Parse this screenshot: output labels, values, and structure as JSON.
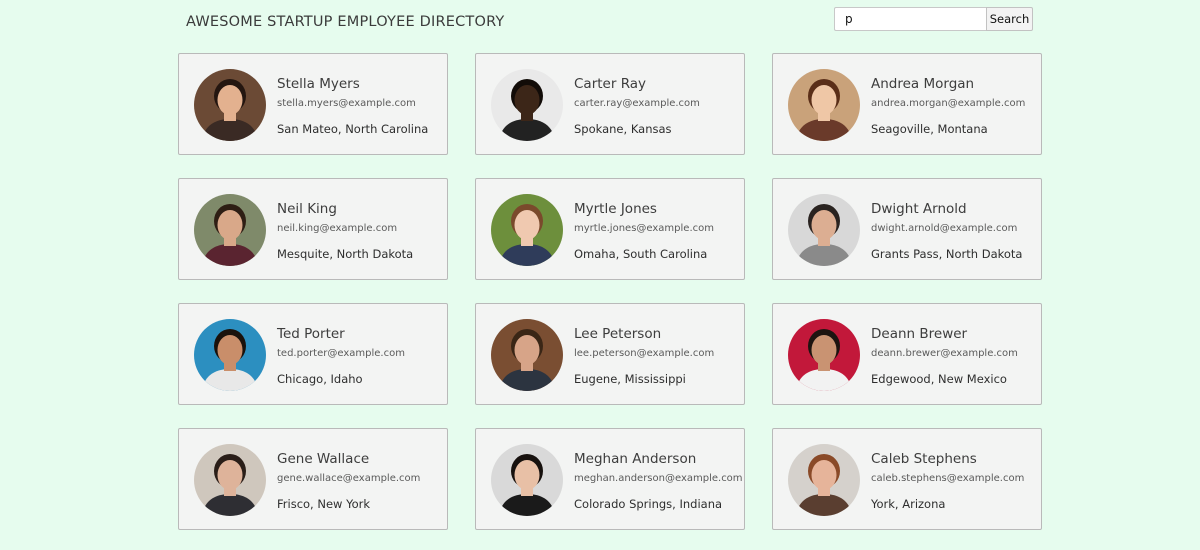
{
  "header": {
    "title": "AWESOME STARTUP EMPLOYEE DIRECTORY"
  },
  "search": {
    "value": "p",
    "button_label": "Search"
  },
  "employees": [
    {
      "name": "Stella Myers",
      "email": "stella.myers@example.com",
      "location": "San Mateo, North Carolina",
      "bg": "#6b4a35",
      "skin": "#e3b18f",
      "hair": "#241610",
      "shirt": "#3a2a24"
    },
    {
      "name": "Carter Ray",
      "email": "carter.ray@example.com",
      "location": "Spokane, Kansas",
      "bg": "#e9e9e9",
      "skin": "#3c2618",
      "hair": "#120c08",
      "shirt": "#222222"
    },
    {
      "name": "Andrea Morgan",
      "email": "andrea.morgan@example.com",
      "location": "Seagoville, Montana",
      "bg": "#c9a27a",
      "skin": "#efc7a6",
      "hair": "#5a2e18",
      "shirt": "#6a3a2a"
    },
    {
      "name": "Neil King",
      "email": "neil.king@example.com",
      "location": "Mesquite, North Dakota",
      "bg": "#7f8a6a",
      "skin": "#d9a889",
      "hair": "#2e1e14",
      "shirt": "#5a2430"
    },
    {
      "name": "Myrtle Jones",
      "email": "myrtle.jones@example.com",
      "location": "Omaha, South Carolina",
      "bg": "#6d8f3c",
      "skin": "#f0c9b0",
      "hair": "#7a4a2c",
      "shirt": "#2f3c5a"
    },
    {
      "name": "Dwight Arnold",
      "email": "dwight.arnold@example.com",
      "location": "Grants Pass, North Dakota",
      "bg": "#d8d8d8",
      "skin": "#dcae92",
      "hair": "#2a2320",
      "shirt": "#8a8a8a"
    },
    {
      "name": "Ted Porter",
      "email": "ted.porter@example.com",
      "location": "Chicago, Idaho",
      "bg": "#2c8fc0",
      "skin": "#c98e6a",
      "hair": "#1a120c",
      "shirt": "#e8e8e8"
    },
    {
      "name": "Lee Peterson",
      "email": "lee.peterson@example.com",
      "location": "Eugene, Mississippi",
      "bg": "#7a4e32",
      "skin": "#d7a488",
      "hair": "#3a2616",
      "shirt": "#2c3440"
    },
    {
      "name": "Deann Brewer",
      "email": "deann.brewer@example.com",
      "location": "Edgewood, New Mexico",
      "bg": "#c2183a",
      "skin": "#c99372",
      "hair": "#1d1410",
      "shirt": "#f2f2f2"
    },
    {
      "name": "Gene Wallace",
      "email": "gene.wallace@example.com",
      "location": "Frisco, New York",
      "bg": "#cfc7bd",
      "skin": "#deb39a",
      "hair": "#2a1e18",
      "shirt": "#2e2e33"
    },
    {
      "name": "Meghan Anderson",
      "email": "meghan.anderson@example.com",
      "location": "Colorado Springs, Indiana",
      "bg": "#d9d9d9",
      "skin": "#e8c0a6",
      "hair": "#17110e",
      "shirt": "#1a1a1a"
    },
    {
      "name": "Caleb Stephens",
      "email": "caleb.stephens@example.com",
      "location": "York, Arizona",
      "bg": "#d5d1cc",
      "skin": "#e6b49a",
      "hair": "#8a4a28",
      "shirt": "#5a3e30"
    }
  ]
}
